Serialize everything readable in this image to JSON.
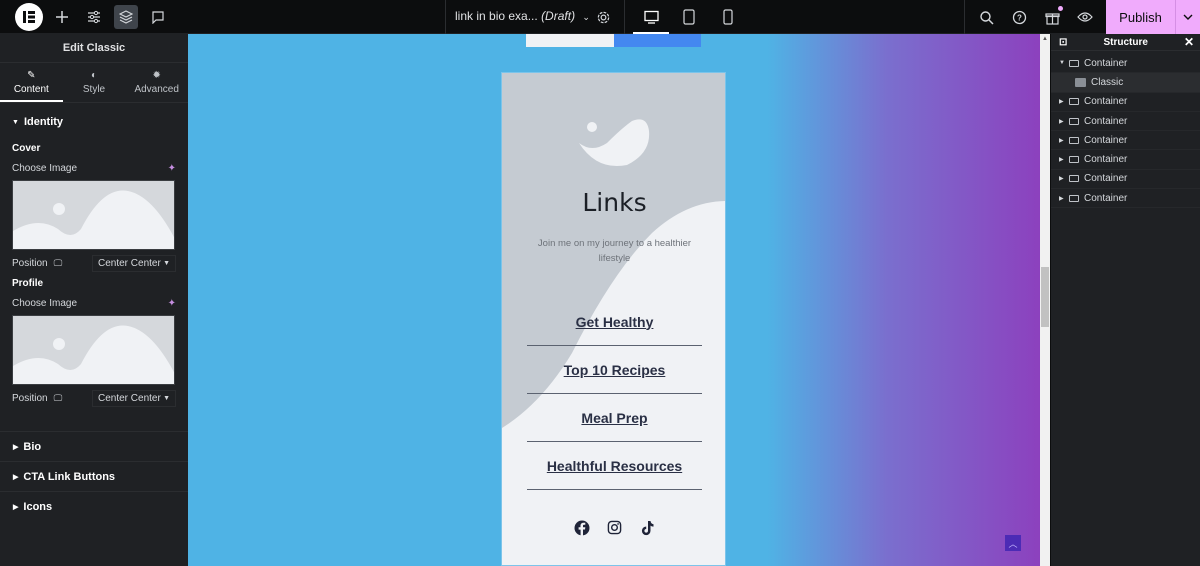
{
  "topbar": {
    "logo": "elementor-logo",
    "tools": [
      "add-element-icon",
      "site-settings-icon",
      "structure-layers-icon",
      "notes-icon"
    ],
    "doc_title": "link in bio exa...",
    "doc_status": "(Draft)",
    "devices": [
      "desktop",
      "tablet",
      "mobile"
    ],
    "active_device": "desktop",
    "right_icons": [
      "search-icon",
      "help-icon",
      "whats-new-gift-icon",
      "preview-eye-icon"
    ],
    "publish_label": "Publish"
  },
  "left_panel": {
    "title": "Edit Classic",
    "tabs": [
      {
        "label": "Content",
        "icon": "pencil-icon",
        "active": true
      },
      {
        "label": "Style",
        "icon": "half-circle-icon",
        "active": false
      },
      {
        "label": "Advanced",
        "icon": "gear-icon",
        "active": false
      }
    ],
    "identity": {
      "heading": "Identity",
      "cover_label": "Cover",
      "cover_choose": "Choose Image",
      "cover_position_label": "Position",
      "cover_position_value": "Center Center",
      "profile_label": "Profile",
      "profile_choose": "Choose Image",
      "profile_position_label": "Position",
      "profile_position_value": "Center Center"
    },
    "sections": [
      "Bio",
      "CTA Link Buttons",
      "Icons"
    ]
  },
  "canvas": {
    "title": "Links",
    "bio": "Join me on my journey to a healthier lifestyle",
    "links": [
      "Get Healthy",
      "Top 10 Recipes",
      "Meal Prep",
      "Healthful Resources"
    ],
    "socials": [
      "facebook-icon",
      "instagram-icon",
      "tiktok-icon"
    ],
    "colors": {
      "bg_left": "#4fb3e5",
      "bg_right": "#8c41be",
      "link_text": "#2a3045"
    }
  },
  "structure": {
    "title": "Structure",
    "items": [
      {
        "label": "Container",
        "expanded": true
      },
      {
        "label": "Classic",
        "child": true
      },
      {
        "label": "Container"
      },
      {
        "label": "Container"
      },
      {
        "label": "Container"
      },
      {
        "label": "Container"
      },
      {
        "label": "Container"
      },
      {
        "label": "Container"
      }
    ]
  }
}
